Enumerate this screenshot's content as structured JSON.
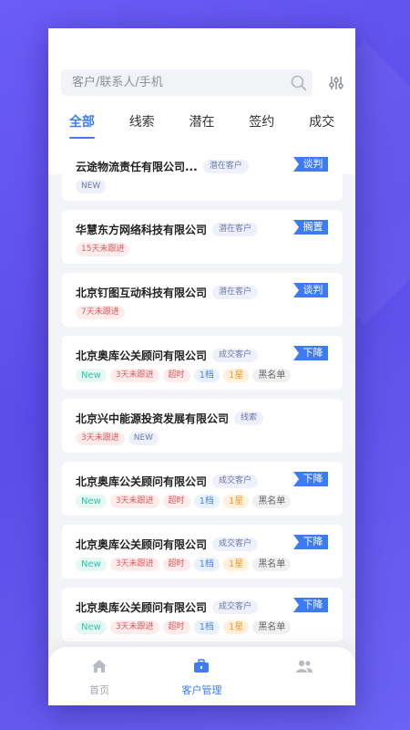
{
  "search": {
    "placeholder": "客户/联系人/手机"
  },
  "tabs": [
    {
      "label": "全部",
      "active": true
    },
    {
      "label": "线索"
    },
    {
      "label": "潜在"
    },
    {
      "label": "签约"
    },
    {
      "label": "成交"
    }
  ],
  "customers": [
    {
      "name": "云途物流责任有限公司...",
      "stage": "潜在客户",
      "status": "谈判",
      "tags": [
        "NEW"
      ]
    },
    {
      "name": "华慧东方网络科技有限公司",
      "stage": "潜在客户",
      "status": "搁置",
      "tags": [
        "15天未跟进"
      ]
    },
    {
      "name": "北京钉图互动科技有限公司",
      "stage": "潜在客户",
      "status": "谈判",
      "tags": [
        "7天未跟进"
      ]
    },
    {
      "name": "北京奥库公关顾问有限公司",
      "stage": "成交客户",
      "status": "下降",
      "tags": [
        "New",
        "3天未跟进",
        "超时",
        "1档",
        "1星",
        "黑名单"
      ]
    },
    {
      "name": "北京兴中能源投资发展有限公司",
      "stage": "线索",
      "status": "",
      "tags": [
        "3天未跟进",
        "NEW"
      ]
    },
    {
      "name": "北京奥库公关顾问有限公司",
      "stage": "成交客户",
      "status": "下降",
      "tags": [
        "New",
        "3天未跟进",
        "超时",
        "1档",
        "1星",
        "黑名单"
      ]
    },
    {
      "name": "北京奥库公关顾问有限公司",
      "stage": "成交客户",
      "status": "下降",
      "tags": [
        "New",
        "3天未跟进",
        "超时",
        "1档",
        "1星",
        "黑名单"
      ]
    },
    {
      "name": "北京奥库公关顾问有限公司",
      "stage": "成交客户",
      "status": "下降",
      "tags": [
        "New",
        "3天未跟进",
        "超时",
        "1档",
        "1星",
        "黑名单"
      ]
    }
  ],
  "nav": [
    {
      "label": "首页",
      "icon": "home-icon"
    },
    {
      "label": "客户管理",
      "icon": "briefcase-icon",
      "active": true
    },
    {
      "label": "",
      "icon": "contacts-icon"
    }
  ],
  "colors": {
    "accent": "#3f7cf4",
    "background": "#6a5cf5"
  }
}
